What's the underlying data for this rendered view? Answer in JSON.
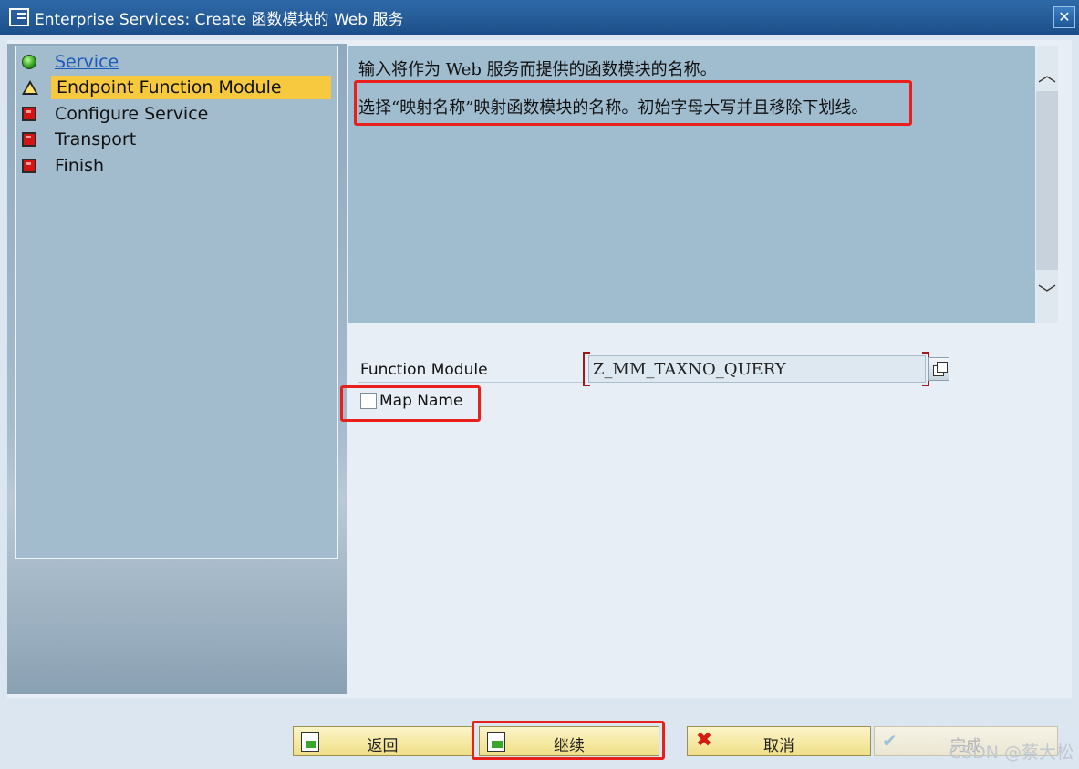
{
  "window": {
    "title": "Enterprise Services: Create 函数模块的 Web 服务",
    "close_label": "✕"
  },
  "steps": [
    {
      "label": "Service",
      "status": "green",
      "link": true
    },
    {
      "label": "Endpoint Function Module",
      "status": "yellow",
      "active": true
    },
    {
      "label": "Configure Service",
      "status": "red"
    },
    {
      "label": "Transport",
      "status": "red"
    },
    {
      "label": "Finish",
      "status": "red"
    }
  ],
  "info": {
    "line1": "输入将作为 Web 服务而提供的函数模块的名称。",
    "line2": "选择“映射名称”映射函数模块的名称。初始字母大写并且移除下划线。"
  },
  "form": {
    "function_module_label": "Function Module",
    "function_module_value": "Z_MM_TAXNO_QUERY",
    "map_name_label": "Map Name",
    "map_name_checked": false
  },
  "buttons": {
    "back": "返回",
    "continue": "继续",
    "cancel": "取消",
    "finish": "完成"
  },
  "scroll": {
    "up": "︿",
    "down": "﹀"
  },
  "watermark": "CSDN @蔡大松",
  "colors": {
    "accent_highlight": "#f7c93e",
    "annotation_red": "#e8201c",
    "title_bar": "#1c4f8a"
  }
}
